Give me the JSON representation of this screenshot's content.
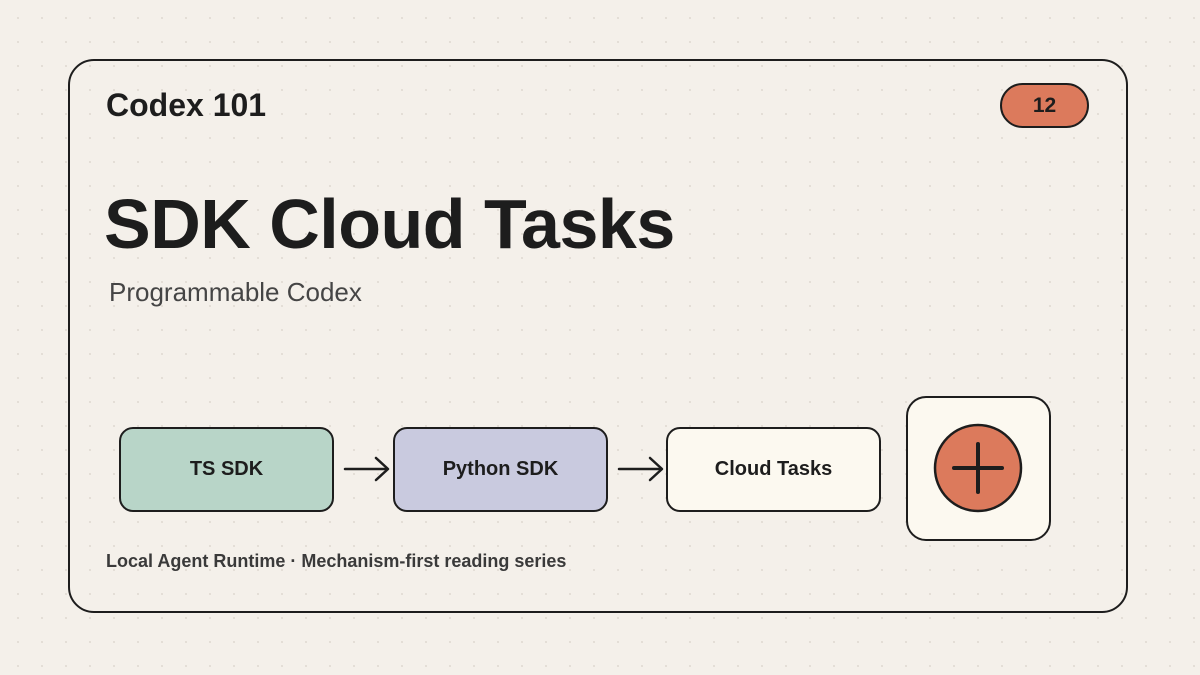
{
  "header": {
    "series_title": "Codex 101",
    "page_number": "12"
  },
  "main": {
    "title": "SDK Cloud Tasks",
    "subtitle": "Programmable Codex"
  },
  "flow": {
    "steps": [
      {
        "label": "TS SDK",
        "color": "#b8d5c8"
      },
      {
        "label": "Python SDK",
        "color": "#c9cadf"
      },
      {
        "label": "Cloud Tasks",
        "color": "#fcf9f0"
      }
    ],
    "connector_icon": "arrow-right-icon",
    "end_icon": "plus-circle-icon",
    "end_icon_color": "#dc7a5c"
  },
  "footer": {
    "text": "Local Agent Runtime · Mechanism-first reading series"
  },
  "colors": {
    "background": "#f4f0ea",
    "ink": "#1d1d1d",
    "accent": "#dc7a5c"
  }
}
